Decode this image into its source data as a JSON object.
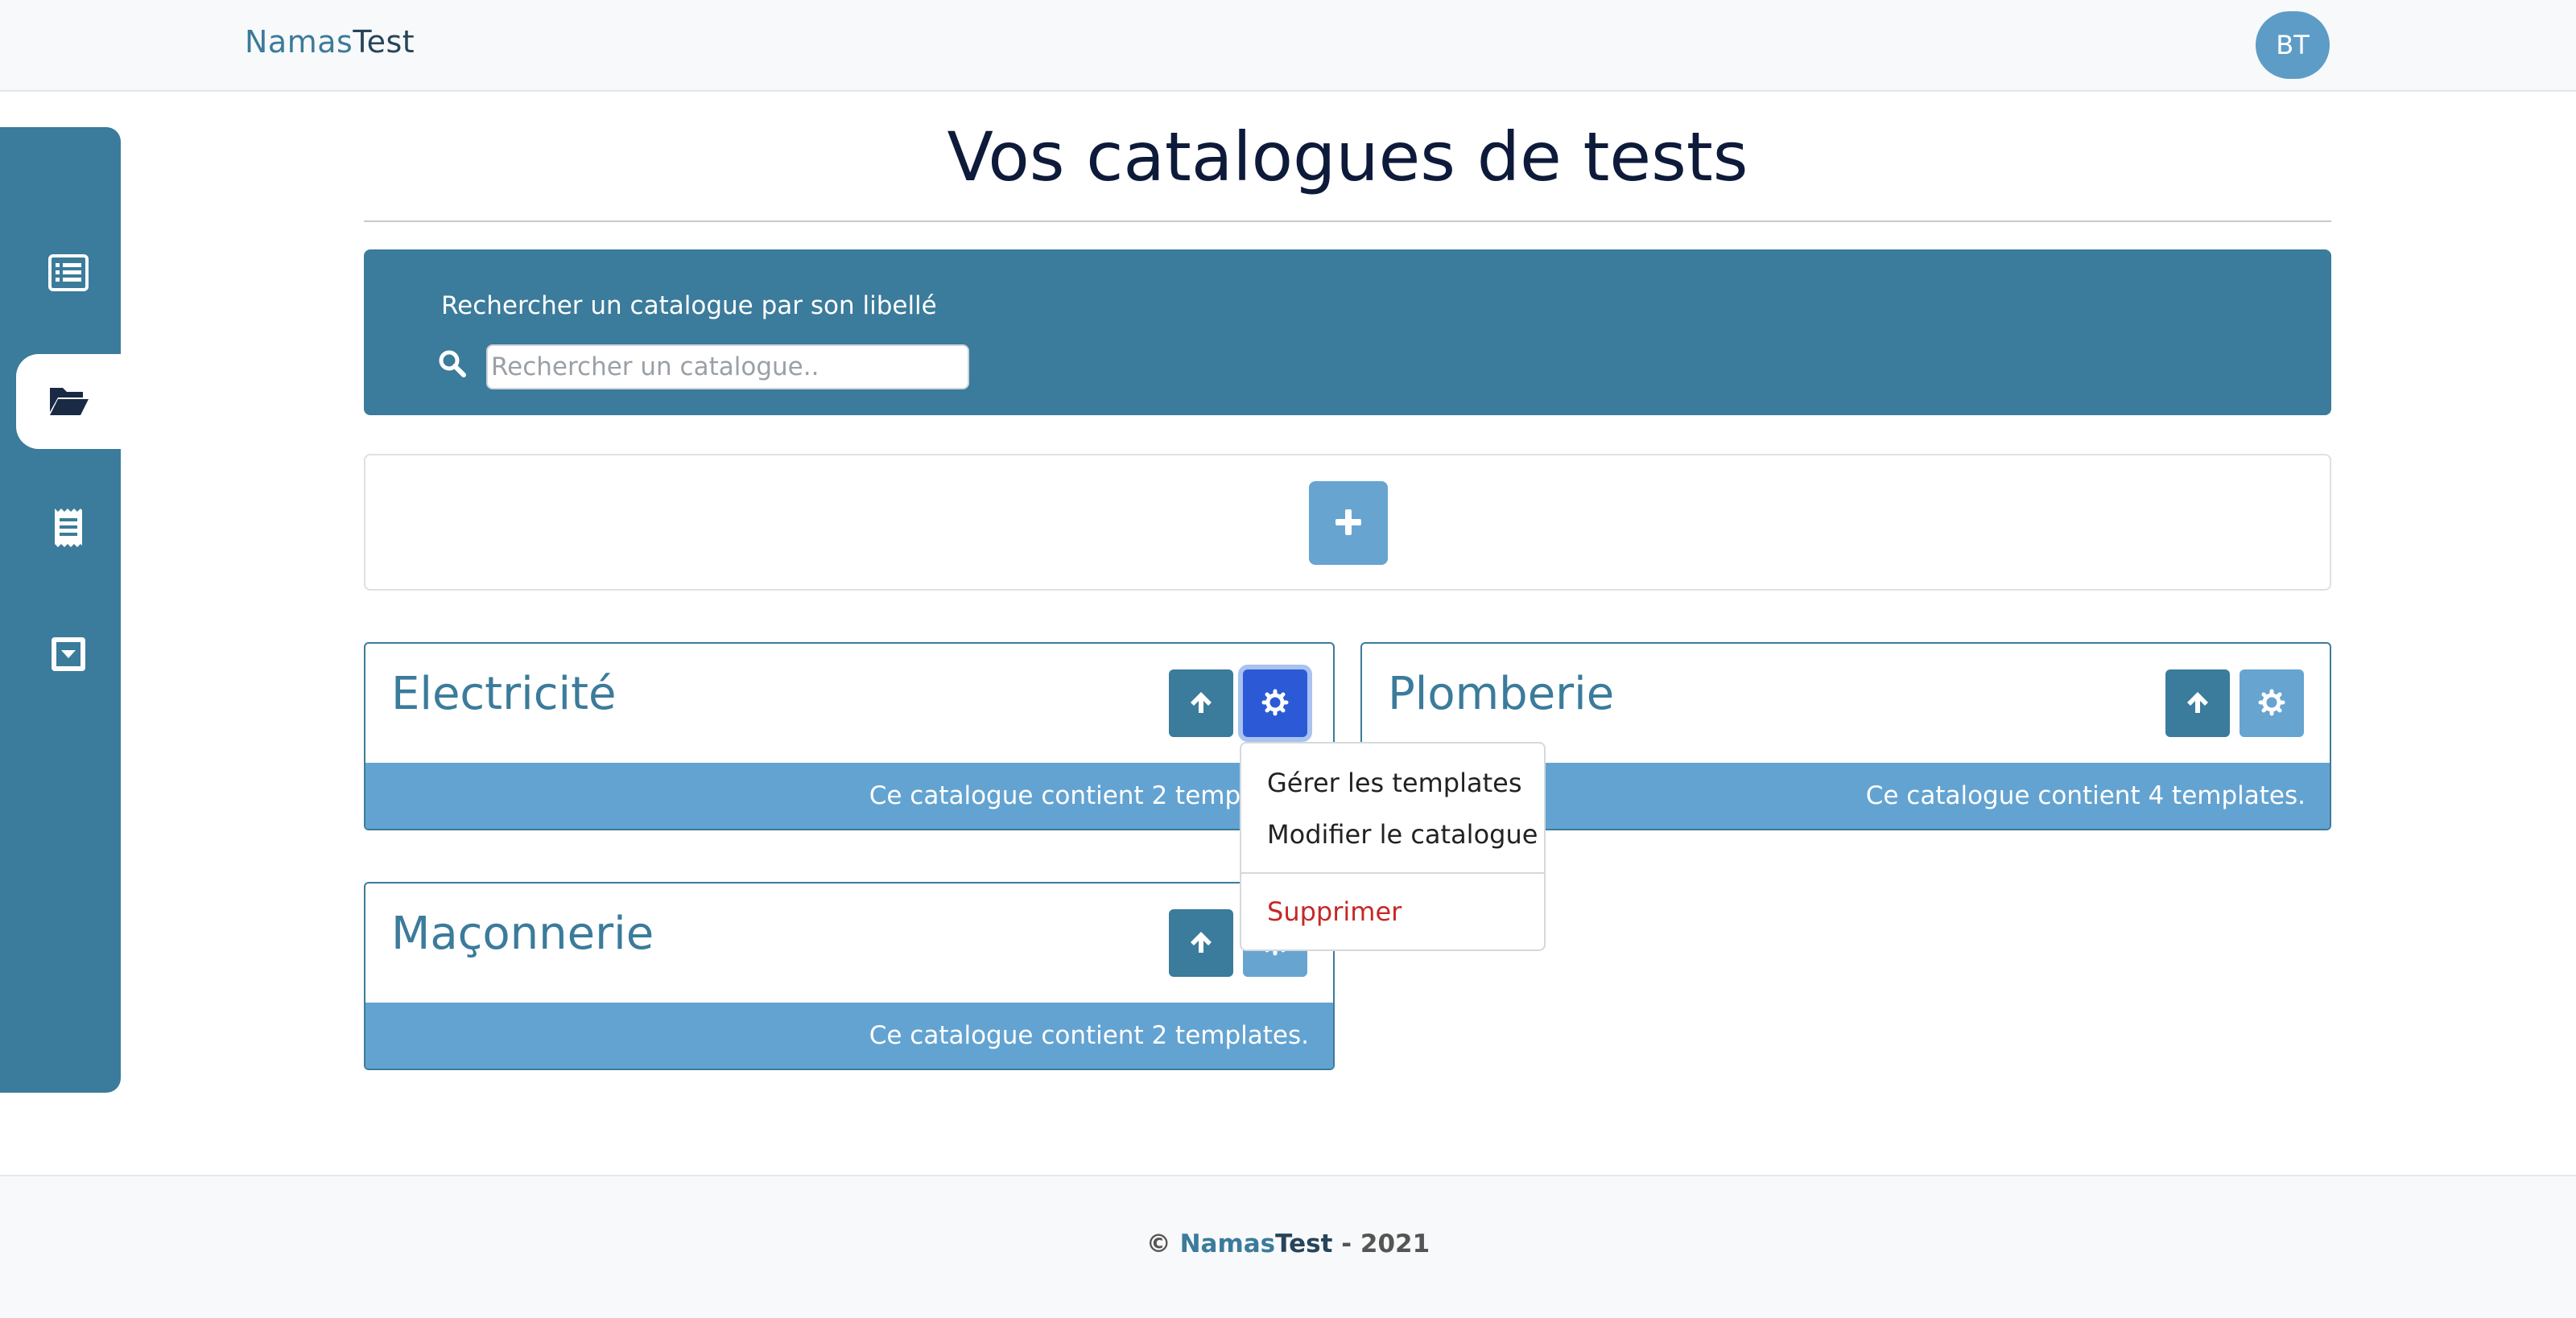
{
  "navbar": {
    "brand_part1": "Namas",
    "brand_part2": "Test",
    "avatar_initials": "BT"
  },
  "sidebar": {
    "items": [
      {
        "icon": "list-icon",
        "active": false
      },
      {
        "icon": "folder-open-icon",
        "active": true
      },
      {
        "icon": "receipt-icon",
        "active": false
      },
      {
        "icon": "caret-square-down-icon",
        "active": false
      }
    ]
  },
  "page": {
    "title": "Vos catalogues de tests"
  },
  "search": {
    "label": "Rechercher un catalogue par son libellé",
    "placeholder": "Rechercher un catalogue..",
    "value": ""
  },
  "add_button": {
    "icon": "plus-icon"
  },
  "catalogs": [
    {
      "title": "Electricité",
      "footer": "Ce catalogue contient 2 templates."
    },
    {
      "title": "Plomberie",
      "footer": "Ce catalogue contient 4 templates."
    },
    {
      "title": "Maçonnerie",
      "footer": "Ce catalogue contient 2 templates."
    }
  ],
  "dropdown": {
    "items": [
      "Gérer les templates",
      "Modifier le catalogue"
    ],
    "danger_item": "Supprimer"
  },
  "footer": {
    "copyright": "©",
    "brand_part1": "Namas",
    "brand_part2": "Test",
    "year_suffix": "- 2021"
  },
  "colors": {
    "primary": "#3b7b9b",
    "light": "#63a3d1",
    "active_gear": "#2c5ad6",
    "danger": "#c62828"
  }
}
